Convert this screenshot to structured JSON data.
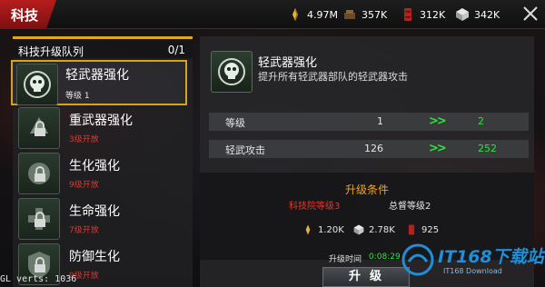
{
  "header": {
    "title": "科技",
    "resources": [
      {
        "icon": "food-icon",
        "value": "4.97M"
      },
      {
        "icon": "iron-icon",
        "value": "357K"
      },
      {
        "icon": "oil-icon",
        "value": "312K"
      },
      {
        "icon": "steel-icon",
        "value": "342K"
      }
    ],
    "close_icon": "close-icon"
  },
  "queue": {
    "label": "科技升级队列",
    "count": "0/1",
    "items": [
      {
        "name": "轻武器强化",
        "sub": "等级 1",
        "selected": true,
        "locked": false
      },
      {
        "name": "重武器强化",
        "sub": "3级开放",
        "locked": true
      },
      {
        "name": "生化强化",
        "sub": "9级开放",
        "locked": true
      },
      {
        "name": "生命强化",
        "sub": "7级开放",
        "locked": true
      },
      {
        "name": "防御生化",
        "sub": "9级开放",
        "locked": true
      }
    ]
  },
  "detail": {
    "title": "轻武器强化",
    "desc": "提升所有轻武器部队的轻武器攻击",
    "stats": [
      {
        "label": "等级",
        "current": "1",
        "arrow": ">>",
        "next": "2"
      },
      {
        "label": "轻武攻击",
        "current": "126",
        "arrow": ">>",
        "next": "252"
      }
    ],
    "conditions": {
      "title": "升级条件",
      "req_missing": "科技院等级3",
      "req_ok": "总督等级2",
      "costs": [
        {
          "icon": "food-icon",
          "value": "1.20K"
        },
        {
          "icon": "iron-icon",
          "value": "2.78K"
        },
        {
          "icon": "oil-icon",
          "value": "925"
        }
      ]
    },
    "time_label": "升级时间",
    "time_value": "0:08:29",
    "upgrade_label": "升级"
  },
  "debug": {
    "gl_verts": "GL verts: 1036"
  },
  "watermark": {
    "text": "IT168下载站",
    "sub": "IT168 Download"
  },
  "colors": {
    "accent_gold": "#d9a21e",
    "title_red": "#b51d1d",
    "locked_red": "#e8332a",
    "upgrade_green": "#2ee33c",
    "condition_orange": "#f2a51a"
  }
}
